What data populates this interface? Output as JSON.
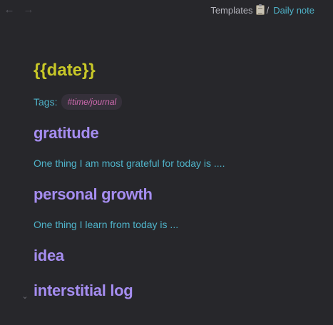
{
  "nav": {
    "back_icon": "arrow-left-icon",
    "forward_icon": "arrow-right-icon",
    "back_glyph": "←",
    "forward_glyph": "→"
  },
  "breadcrumb": {
    "folder": "Templates",
    "folder_icon": "clipboard-icon",
    "separator": "/",
    "current": "Daily note"
  },
  "note": {
    "title": "{{date}}",
    "tags_label": "Tags:",
    "tag": "#time/journal",
    "sections": [
      {
        "heading": "gratitude",
        "body": "One thing I am most grateful for today is ...."
      },
      {
        "heading": "personal growth",
        "body": "One thing I learn from today is ..."
      },
      {
        "heading": "idea"
      },
      {
        "heading": "interstitial log",
        "fold_glyph": "⌄"
      }
    ]
  },
  "colors": {
    "background": "#27272b",
    "title": "#c8c828",
    "heading": "#a58df0",
    "text_accent": "#4fb3c9",
    "tag": "#d06ab0",
    "tag_background": "#35303a"
  }
}
